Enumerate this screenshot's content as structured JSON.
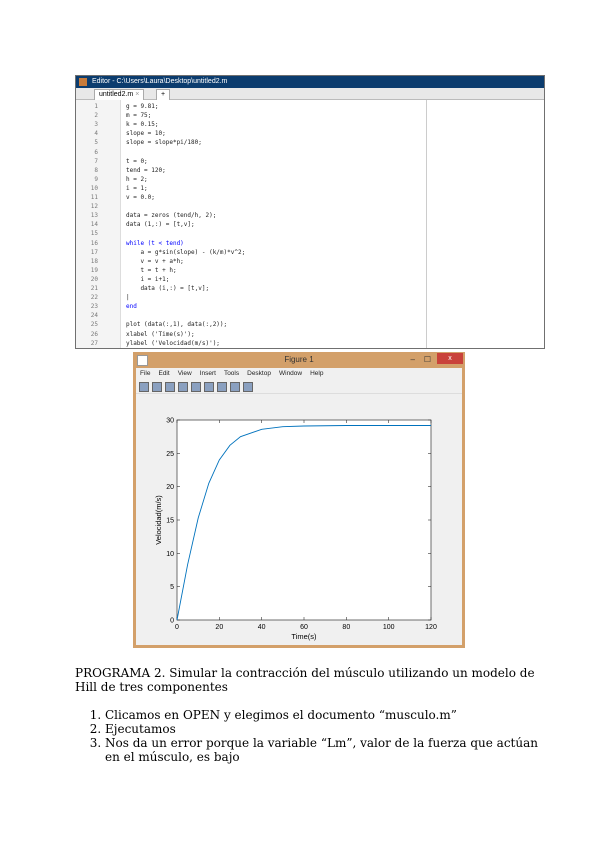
{
  "editor": {
    "title": "Editor - C:\\Users\\Laura\\Desktop\\untitled2.m",
    "tab": "untitled2.m",
    "tab_close": "×",
    "new_tab": "+",
    "lines": [
      {
        "n": "1",
        "code": "g = 9.81;"
      },
      {
        "n": "2",
        "code": "m = 75;"
      },
      {
        "n": "3",
        "code": "k = 0.15;"
      },
      {
        "n": "4",
        "code": "slope = 10;"
      },
      {
        "n": "5",
        "code": "slope = slope*pi/180;"
      },
      {
        "n": "6",
        "code": ""
      },
      {
        "n": "7",
        "code": "t = 0;"
      },
      {
        "n": "8",
        "code": "tend = 120;"
      },
      {
        "n": "9",
        "code": "h = 2;"
      },
      {
        "n": "10",
        "code": "i = 1;"
      },
      {
        "n": "11",
        "code": "v = 0.0;"
      },
      {
        "n": "12",
        "code": ""
      },
      {
        "n": "13",
        "code": "data = zeros (tend/h, 2);"
      },
      {
        "n": "14",
        "code": "data (1,:) = [t,v];"
      },
      {
        "n": "15",
        "code": ""
      },
      {
        "n": "16",
        "code": "while (t < tend)",
        "kw": true
      },
      {
        "n": "17",
        "code": "    a = g*sin(slope) - (k/m)*v^2;"
      },
      {
        "n": "18",
        "code": "    v = v + a*h;"
      },
      {
        "n": "19",
        "code": "    t = t + h;"
      },
      {
        "n": "20",
        "code": "    i = i+1;"
      },
      {
        "n": "21",
        "code": "    data (i,:) = [t,v];"
      },
      {
        "n": "22",
        "code": "|"
      },
      {
        "n": "23",
        "code": "end",
        "kw": true
      },
      {
        "n": "24",
        "code": ""
      },
      {
        "n": "25",
        "code": "plot (data(:,1), data(:,2));"
      },
      {
        "n": "26",
        "code": "xlabel ('Time(s)');"
      },
      {
        "n": "27",
        "code": "ylabel ('Velocidad(m/s)');"
      }
    ]
  },
  "figure": {
    "title": "Figure 1",
    "menu": [
      "File",
      "Edit",
      "View",
      "Insert",
      "Tools",
      "Desktop",
      "Window",
      "Help"
    ],
    "close": "x",
    "minimize": "–",
    "maximize": "☐"
  },
  "chart_data": {
    "type": "line",
    "xlabel": "Time(s)",
    "ylabel": "Velocidad(m/s)",
    "xlim": [
      0,
      120
    ],
    "ylim": [
      0,
      30
    ],
    "xticks": [
      0,
      20,
      40,
      60,
      80,
      100,
      120
    ],
    "yticks": [
      0,
      5,
      10,
      15,
      20,
      25,
      30
    ],
    "x": [
      0,
      5,
      10,
      15,
      20,
      25,
      30,
      40,
      50,
      60,
      80,
      100,
      120
    ],
    "y": [
      0,
      8.3,
      15.3,
      20.5,
      24.0,
      26.2,
      27.5,
      28.6,
      29.0,
      29.1,
      29.18,
      29.18,
      29.18
    ],
    "color": "#0072bd"
  },
  "text": {
    "heading": "PROGRAMA 2. Simular la contracción del músculo utilizando un modelo de Hill de tres componentes",
    "items": [
      "Clicamos en OPEN y elegimos el documento “musculo.m”",
      "Ejecutamos",
      "Nos da un error porque la variable “Lm”, valor de la fuerza que actúan en el músculo, es bajo"
    ]
  }
}
